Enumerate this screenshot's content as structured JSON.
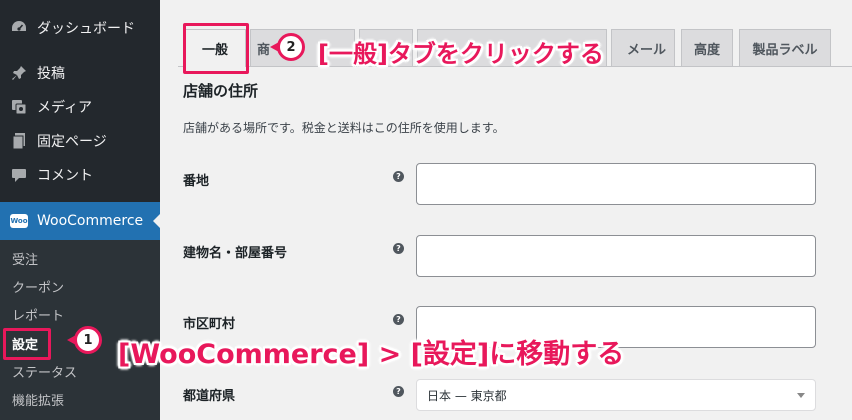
{
  "sidebar": {
    "items": [
      {
        "label": "ダッシュボード",
        "icon": "dashboard-icon"
      },
      {
        "label": "投稿",
        "icon": "pin-icon"
      },
      {
        "label": "メディア",
        "icon": "media-icon"
      },
      {
        "label": "固定ページ",
        "icon": "page-icon"
      },
      {
        "label": "コメント",
        "icon": "comment-icon"
      }
    ],
    "woocommerce": {
      "label": "WooCommerce",
      "badge": "Woo"
    },
    "submenu": [
      "受注",
      "クーポン",
      "レポート",
      "設定",
      "ステータス",
      "機能拡張"
    ]
  },
  "tabs": [
    "一般",
    "商",
    "",
    "",
    "",
    "メール",
    "高度",
    "製品ラベル"
  ],
  "main": {
    "section_title": "店舗の住所",
    "section_desc": "店舗がある場所です。税金と送料はこの住所を使用します。",
    "fields": [
      "番地",
      "建物名・部屋番号",
      "市区町村",
      "都道府県"
    ],
    "help_glyph": "?",
    "select_value": "日本 — 東京都"
  },
  "annotations": {
    "step1_number": "1",
    "step1_text": "[WooCommerce] > [設定]に移動する",
    "step2_number": "2",
    "step2_text": "[一般]タブをクリックする",
    "color": "#e8185b"
  }
}
